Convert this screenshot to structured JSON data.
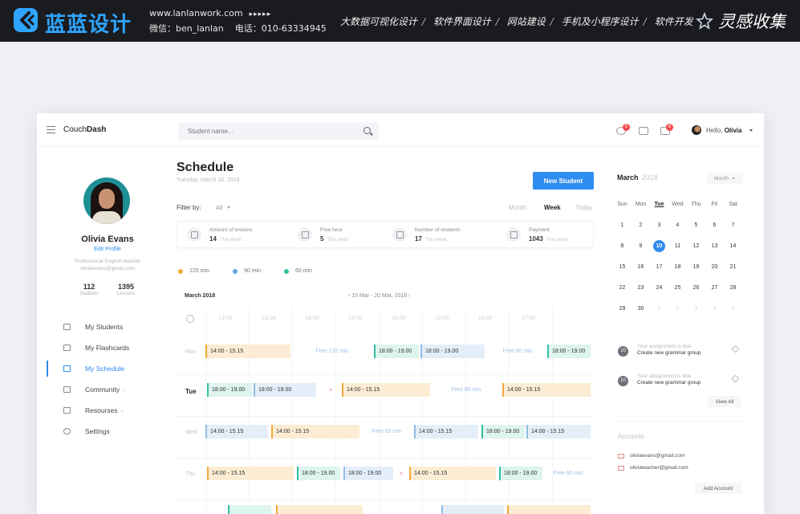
{
  "banner": {
    "brand_name": "蓝蓝设计",
    "website": "www.lanlanwork.com",
    "arrows": "▸▸▸▸▸",
    "wechat": "微信：ben_lanlan",
    "phone": "电话：010-63334945",
    "services": [
      "大数据可视化设计",
      "软件界面设计",
      "网站建设",
      "手机及小程序设计",
      "软件开发"
    ],
    "collection": "灵感收集",
    "brand_color": "#2ea4ff"
  },
  "app": {
    "name_light": "Couch",
    "name_bold": "Dash",
    "search_placeholder": "Student name...",
    "notif_count_1": "5",
    "notif_count_2": "8",
    "greeting_prefix": "Hello,",
    "greeting_name": "Olivia"
  },
  "profile": {
    "name": "Olivia Evans",
    "edit_label": "Edit Profile",
    "description": "Professional English teacher",
    "email": "oliviaevans@gmail.com",
    "stats": [
      {
        "value": "112",
        "label": "Students"
      },
      {
        "value": "1395",
        "label": "Lessons"
      }
    ]
  },
  "nav": [
    {
      "label": "My Students",
      "icon": "students-icon"
    },
    {
      "label": "My Flashcards",
      "icon": "flashcards-icon"
    },
    {
      "label": "My Schedule",
      "icon": "schedule-icon",
      "active": true
    },
    {
      "label": "Community",
      "icon": "community-icon",
      "caret": "⌄"
    },
    {
      "label": "Resourses",
      "icon": "resources-icon",
      "caret": "⌄"
    },
    {
      "label": "Settings",
      "icon": "settings-icon"
    }
  ],
  "schedule": {
    "title": "Schedule",
    "date": "Tuesday, March 10, 2018",
    "new_student_label": "New Student",
    "filter_label": "Filter by:",
    "filter_value": "All",
    "views": [
      "Month",
      "Week",
      "Today"
    ],
    "active_view": "Week",
    "summary": [
      {
        "label": "Amount of lessons",
        "value": "14",
        "sub": "This week"
      },
      {
        "label": "Free hour",
        "value": "5",
        "sub": "This week"
      },
      {
        "label": "Number of students",
        "value": "17",
        "sub": "This week"
      },
      {
        "label": "Payment",
        "value": "1043",
        "sub": "This week"
      }
    ],
    "legend": [
      {
        "label": "120 min",
        "color": "#f3a93a"
      },
      {
        "label": "90 min",
        "color": "#5aa6ea"
      },
      {
        "label": "60 min",
        "color": "#33bfa0"
      }
    ],
    "month": "March 2018",
    "range": "‹  15 Mar - 20 Mar, 2018  ›",
    "times": [
      "13:00",
      "13:00",
      "14:00",
      "14:00",
      "15:00",
      "15:00",
      "16:00",
      "17:00"
    ],
    "days": [
      {
        "label": "Mon",
        "events": [
          {
            "text": "14:00 - 15.15",
            "kind": "orange"
          },
          {
            "text": "Free 120 min",
            "kind": "free"
          },
          {
            "text": "18:00 - 19.00",
            "kind": "teal"
          },
          {
            "text": "18:00 - 19.00",
            "kind": "blue"
          },
          {
            "text": "Free 90 min",
            "kind": "free"
          },
          {
            "text": "18:00 - 19.00",
            "kind": "teal"
          }
        ]
      },
      {
        "label": "Tue",
        "today": true,
        "events": [
          {
            "text": "18:00 - 19.00",
            "kind": "teal"
          },
          {
            "text": "18:00 - 19.00",
            "kind": "blue"
          },
          {
            "text": "×",
            "kind": "x"
          },
          {
            "text": "14:00 - 15.15",
            "kind": "orange"
          },
          {
            "text": "Free 90 min",
            "kind": "free"
          },
          {
            "text": "14:00 - 15.15",
            "kind": "orange"
          }
        ]
      },
      {
        "label": "Wed",
        "events": [
          {
            "text": "14:00 - 15.15",
            "kind": "blue"
          },
          {
            "text": "14:00 - 15.15",
            "kind": "orange"
          },
          {
            "text": "Free 60 min",
            "kind": "free"
          },
          {
            "text": "14:00 - 15.15",
            "kind": "blue"
          },
          {
            "text": "18:00 - 19.00",
            "kind": "teal"
          },
          {
            "text": "14:00 - 15.15",
            "kind": "blue"
          }
        ]
      },
      {
        "label": "Thu",
        "events": [
          {
            "text": "14:00 - 15.15",
            "kind": "orange"
          },
          {
            "text": "18:00 - 19.00",
            "kind": "teal"
          },
          {
            "text": "18:00 - 19.00",
            "kind": "blue"
          },
          {
            "text": "×",
            "kind": "x"
          },
          {
            "text": "14:00 - 15.15",
            "kind": "orange"
          },
          {
            "text": "18:00 - 19.00",
            "kind": "teal"
          },
          {
            "text": "Free 60 min",
            "kind": "free"
          }
        ]
      }
    ]
  },
  "calendar": {
    "month": "March",
    "year": "2018",
    "view_select": "Month",
    "weekdays": [
      "Sun",
      "Mon",
      "Tue",
      "Wed",
      "Thu",
      "Fri",
      "Sat"
    ],
    "selected_weekday": "Tue",
    "weeks": [
      [
        "1",
        "2",
        "3",
        "4",
        "5",
        "6",
        "7"
      ],
      [
        "8",
        "9",
        "10",
        "11",
        "12",
        "13",
        "14"
      ],
      [
        "15",
        "16",
        "17",
        "18",
        "19",
        "20",
        "21"
      ],
      [
        "22",
        "23",
        "24",
        "25",
        "26",
        "27",
        "28"
      ],
      [
        "29",
        "30",
        "1",
        "2",
        "3",
        "4",
        "5"
      ]
    ],
    "today": "10"
  },
  "notifications": [
    {
      "badge": "10",
      "sub": "Your assignment is due",
      "title": "Create new grammar group"
    },
    {
      "badge": "10",
      "sub": "Your assignment is due",
      "title": "Create new grammar group"
    }
  ],
  "view_all_label": "View All",
  "accounts": {
    "title": "Accounts",
    "emails": [
      "oliviaevans@gmail.com",
      "oliviateacher@gmail.com"
    ],
    "add_label": "Add Account"
  },
  "colors": {
    "accent": "#2f8cf0",
    "orange": "#f3a93a",
    "teal": "#33bfa0",
    "badge_red": "#f04a4a"
  }
}
